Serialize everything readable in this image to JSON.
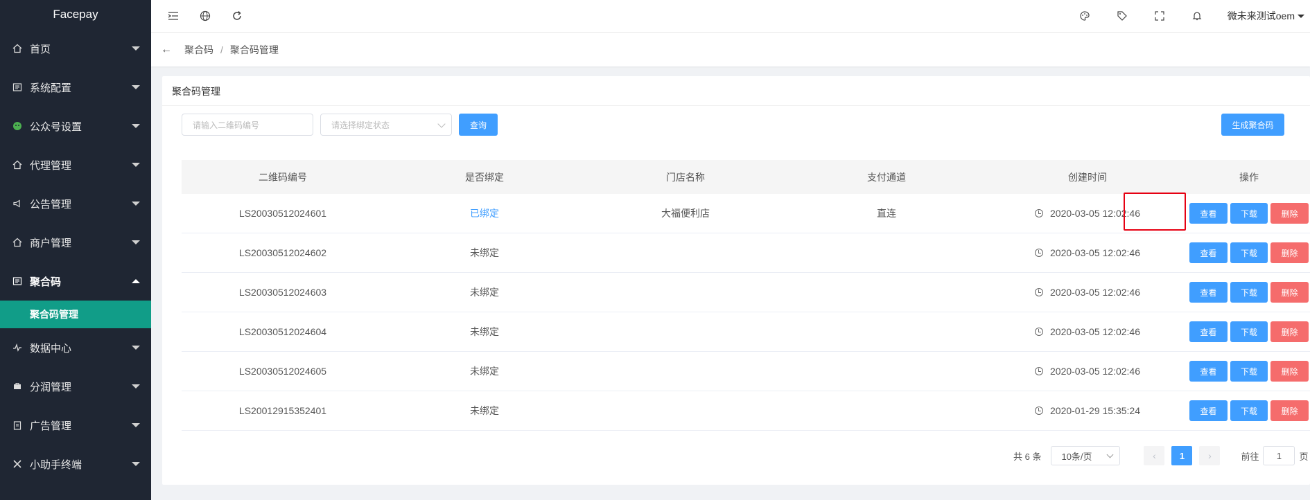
{
  "app": {
    "title": "Facepay"
  },
  "sidebar": {
    "items": [
      {
        "label": "首页",
        "icon": "home-icon"
      },
      {
        "label": "系统配置",
        "icon": "settings-icon"
      },
      {
        "label": "公众号设置",
        "icon": "wechat-icon"
      },
      {
        "label": "代理管理",
        "icon": "home-icon"
      },
      {
        "label": "公告管理",
        "icon": "megaphone-icon"
      },
      {
        "label": "商户管理",
        "icon": "home-icon"
      },
      {
        "label": "聚合码",
        "icon": "qr-icon"
      },
      {
        "label": "数据中心",
        "icon": "pulse-icon"
      },
      {
        "label": "分润管理",
        "icon": "bag-icon"
      },
      {
        "label": "广告管理",
        "icon": "clipboard-icon"
      },
      {
        "label": "小助手终端",
        "icon": "tools-icon"
      }
    ],
    "active_sub": "聚合码管理"
  },
  "topbar": {
    "user": "微未来测试oem"
  },
  "breadcrumb": {
    "parent": "聚合码",
    "separator": "/",
    "current": "聚合码管理"
  },
  "card": {
    "title": "聚合码管理"
  },
  "filters": {
    "code_placeholder": "请输入二维码编号",
    "status_placeholder": "请选择绑定状态",
    "query_label": "查询",
    "generate_label": "生成聚合码"
  },
  "table": {
    "headers": [
      "二维码编号",
      "是否绑定",
      "门店名称",
      "支付通道",
      "创建时间",
      "操作"
    ],
    "rows": [
      {
        "code": "LS20030512024601",
        "bound": "已绑定",
        "store": "大福便利店",
        "channel": "直连",
        "created": "2020-03-05 12:02:46"
      },
      {
        "code": "LS20030512024602",
        "bound": "未绑定",
        "store": "",
        "channel": "",
        "created": "2020-03-05 12:02:46"
      },
      {
        "code": "LS20030512024603",
        "bound": "未绑定",
        "store": "",
        "channel": "",
        "created": "2020-03-05 12:02:46"
      },
      {
        "code": "LS20030512024604",
        "bound": "未绑定",
        "store": "",
        "channel": "",
        "created": "2020-03-05 12:02:46"
      },
      {
        "code": "LS20030512024605",
        "bound": "未绑定",
        "store": "",
        "channel": "",
        "created": "2020-03-05 12:02:46"
      },
      {
        "code": "LS20012915352401",
        "bound": "未绑定",
        "store": "",
        "channel": "",
        "created": "2020-01-29 15:35:24"
      }
    ],
    "actions": {
      "view": "查看",
      "download": "下载",
      "delete": "删除"
    }
  },
  "pagination": {
    "total": "共 6 条",
    "page_size": "10条/页",
    "current_page": "1",
    "goto_prefix": "前往",
    "goto_value": "1",
    "goto_suffix": "页"
  },
  "colors": {
    "sidebar_bg": "#1f2633",
    "active_sub_bg": "#119d88",
    "primary": "#409eff",
    "danger": "#f56c6c",
    "highlight": "#e60012"
  }
}
